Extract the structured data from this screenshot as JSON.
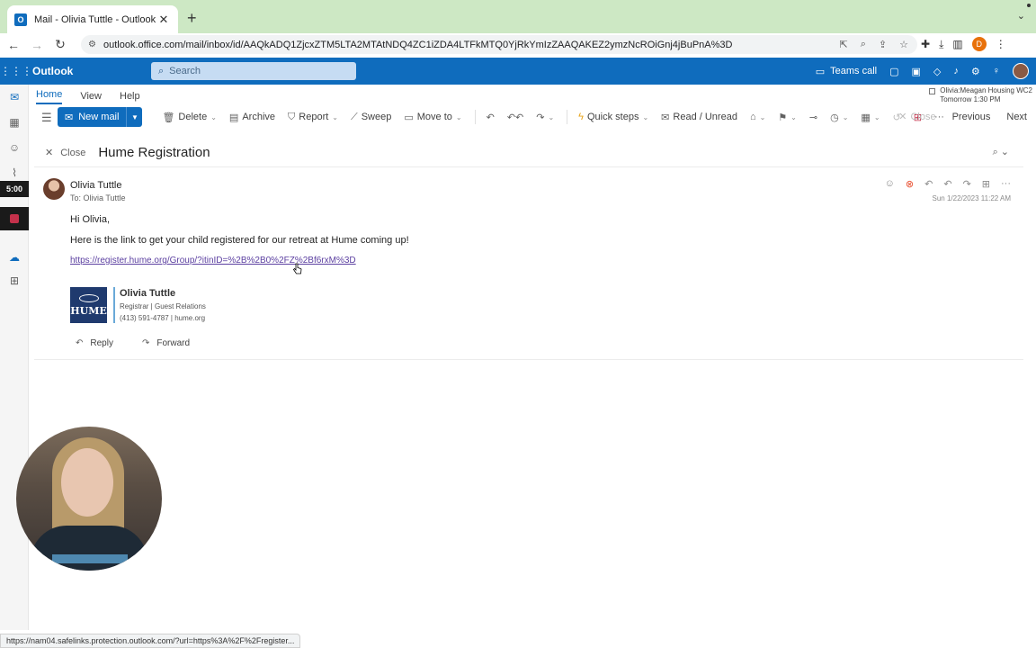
{
  "browser": {
    "tab_title": "Mail - Olivia Tuttle - Outlook",
    "tab_favicon": "O",
    "new_tab": "+",
    "url": "outlook.office.com/mail/inbox/id/AAQkADQ1ZjcxZTM5LTA2MTAtNDQ4ZC1iZDA4LTFkMTQ0YjRkYmIzZAAQAKEZ2ymzNcROiGnj4jBuPnA%3D",
    "profile_initial": "D",
    "status_url": "https://nam04.safelinks.protection.outlook.com/?url=https%3A%2F%2Fregister..."
  },
  "header": {
    "brand": "Outlook",
    "search_placeholder": "Search",
    "teams_call": "Teams call"
  },
  "ribbon": {
    "tabs": [
      "Home",
      "View",
      "Help"
    ],
    "new_mail": "New mail",
    "commands": {
      "delete": "Delete",
      "archive": "Archive",
      "report": "Report",
      "sweep": "Sweep",
      "move_to": "Move to",
      "quick_steps": "Quick steps",
      "read_unread": "Read / Unread",
      "close": "Close",
      "previous": "Previous",
      "next": "Next"
    },
    "meeting": {
      "title": "Olivia:Meagan Housing WC2",
      "time": "Tomorrow 1:30 PM"
    }
  },
  "recording": {
    "timer": "5:00"
  },
  "reading": {
    "close_label": "Close",
    "subject": "Hume Registration",
    "from": "Olivia Tuttle",
    "to": "To:  Olivia Tuttle",
    "date": "Sun 1/22/2023 11:22 AM",
    "greeting": "Hi Olivia,",
    "body": "Here is the link to get your child registered for our retreat at Hume coming up!",
    "link": "https://register.hume.org/Group/?itinID=%2B%2B0%2FZ%2Bf6rxM%3D",
    "signature": {
      "logo_text": "HUME",
      "name": "Olivia Tuttle",
      "title": "Registrar | Guest Relations",
      "contact": "(413) 591-4787 | hume.org"
    },
    "reply": "Reply",
    "forward": "Forward"
  },
  "colors": {
    "outlook_blue": "#0f6cbd",
    "tabstrip_green": "#cde8c4",
    "link_purple": "#5b3fa0",
    "hume_navy": "#1f3a6e"
  }
}
